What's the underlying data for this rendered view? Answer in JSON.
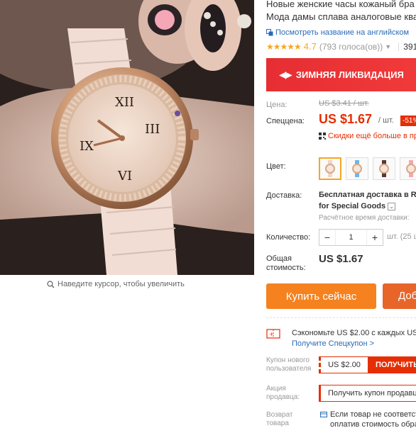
{
  "product": {
    "title_line1": "Новые женские часы кожаный бра",
    "title_line2": "Мода дамы сплава аналоговые ква",
    "translate_link": "Посмотреть название на английском"
  },
  "rating": {
    "stars": "★★★★★",
    "value": "4.7",
    "votes": "(793 голоса(ов))",
    "orders": "391"
  },
  "banner": {
    "text": "ЗИМНЯЯ ЛИКВИДАЦИЯ"
  },
  "price": {
    "label": "Цена:",
    "old": "US $3.41 / шт.",
    "special_label": "Спеццена:",
    "special": "US $1.67",
    "per": "/ шт.",
    "discount": "-51%",
    "coupon_hint": "Скидки ещё больше в пр"
  },
  "color": {
    "label": "Цвет:",
    "options": [
      {
        "name": "pink",
        "band": "#f2d4cc",
        "selected": true
      },
      {
        "name": "blue",
        "band": "#6fb5e8",
        "selected": false
      },
      {
        "name": "brown",
        "band": "#5a3a2a",
        "selected": false
      },
      {
        "name": "rose",
        "band": "#f3a8b0",
        "selected": false
      }
    ]
  },
  "shipping": {
    "label": "Доставка:",
    "line1": "Бесплатная доставка в Ru",
    "line2": "for Special Goods",
    "time": "Расчётное время доставки:"
  },
  "quantity": {
    "label": "Количество:",
    "minus": "−",
    "value": "1",
    "plus": "+",
    "unit": "шт. (25 ш"
  },
  "total": {
    "label_line1": "Общая",
    "label_line2": "стоимость:",
    "value": "US $1.67"
  },
  "actions": {
    "buy": "Купить сейчас",
    "cart": "Доб"
  },
  "savings": {
    "text": "Сэкономьте US $2.00 с каждых US $",
    "link": "Получите Спецкупон >"
  },
  "new_user_coupon": {
    "label_line1": "Купон нового",
    "label_line2": "пользователя",
    "amount": "US $2.00",
    "button": "ПОЛУЧИТЬ"
  },
  "seller_promo": {
    "label_line1": "Акция",
    "label_line2": "продавца:",
    "text": "Получить купон продавца"
  },
  "returns": {
    "label_line1": "Возврат",
    "label_line2": "товара",
    "line1": "Если товар не соответст",
    "line2": "оплатив стоимость обра"
  },
  "image": {
    "zoom_hint": "Наведите курсор, чтобы увеличить"
  },
  "colors": {
    "accent": "#e62e04",
    "buy": "#f5821f",
    "link": "#2a6ab8",
    "star": "#f5a623"
  }
}
